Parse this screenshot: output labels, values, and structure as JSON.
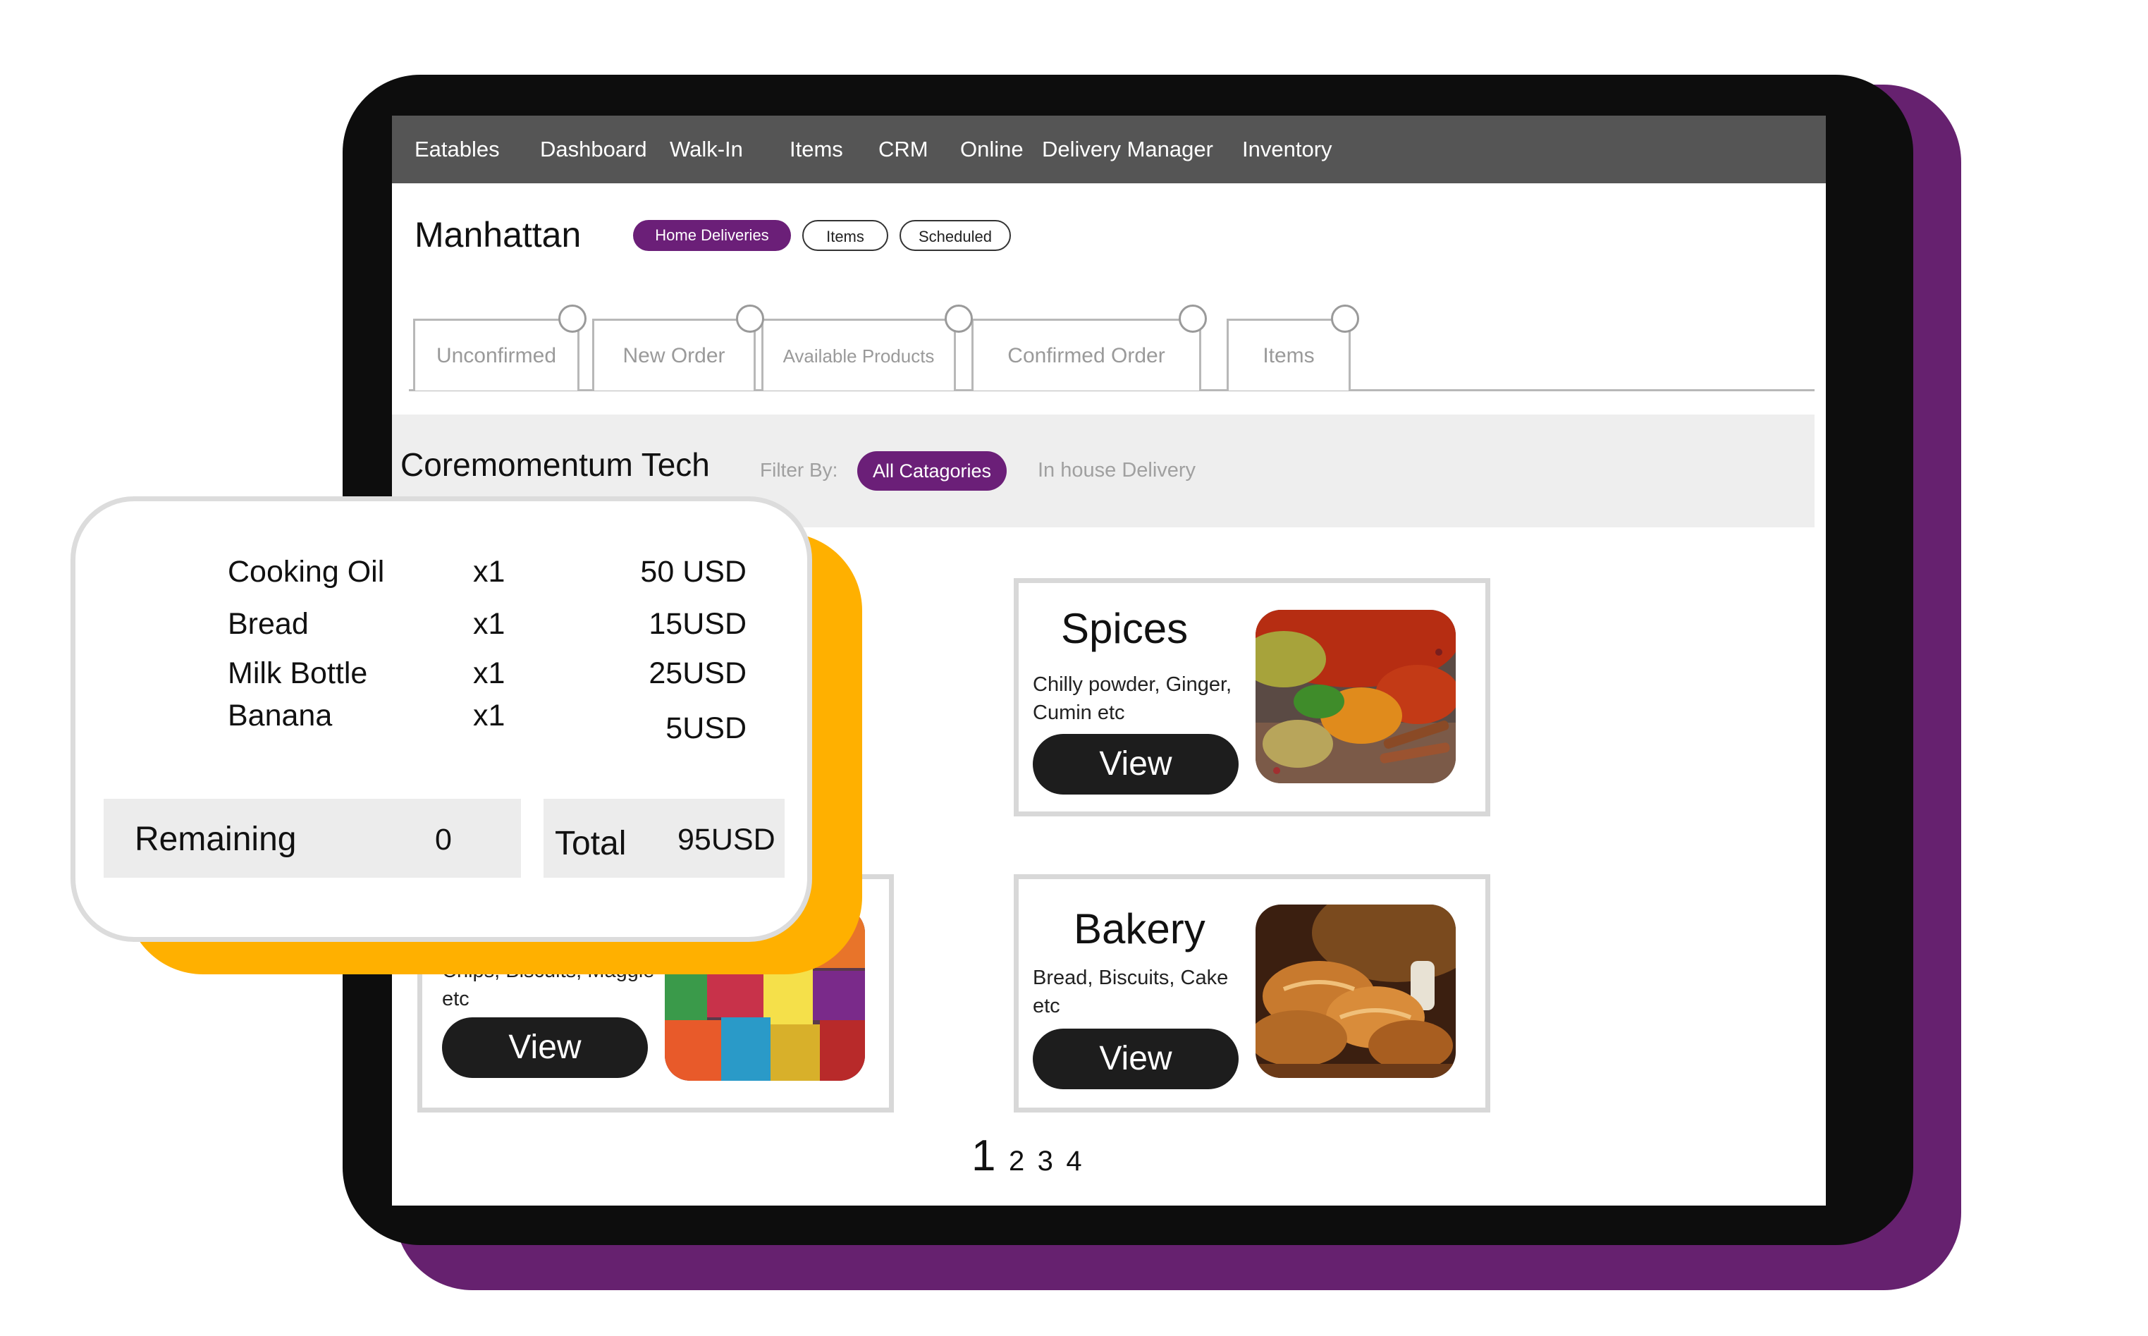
{
  "nav": {
    "items": [
      "Eatables",
      "Dashboard",
      "Walk-In",
      "Items",
      "CRM",
      "Online",
      "Delivery Manager",
      "Inventory"
    ]
  },
  "location": {
    "title": "Manhattan",
    "pills": [
      "Home Deliveries",
      "Items",
      "Scheduled"
    ],
    "active_pill": "Home Deliveries"
  },
  "tabs": [
    "Unconfirmed",
    "New Order",
    "Available Products",
    "Confirmed Order",
    "Items"
  ],
  "filter": {
    "company": "Coremomentum Tech",
    "label": "Filter By:",
    "active": "All Catagories",
    "option": "In house Delivery"
  },
  "cards": [
    {
      "title": "Spices",
      "desc_line1": "Chilly powder, Ginger,",
      "desc_line2": "Cumin etc",
      "button": "View",
      "image": "spices-photo"
    },
    {
      "title": "Bakery",
      "desc_line1": "Bread, Biscuits, Cake",
      "desc_line2": "etc",
      "button": "View",
      "image": "bakery-photo"
    },
    {
      "title": "",
      "desc_line1": "Chips, Biscuits, Maggie",
      "desc_line2": "etc",
      "button": "View",
      "image": "snacks-photo"
    }
  ],
  "pagination": {
    "current": "1",
    "pages": [
      "2",
      "3",
      "4"
    ]
  },
  "order": {
    "items": [
      {
        "name": "Cooking Oil",
        "qty": "x1",
        "price": "50 USD"
      },
      {
        "name": "Bread",
        "qty": "x1",
        "price": "15USD"
      },
      {
        "name": "Milk Bottle",
        "qty": "x1",
        "price": "25USD"
      },
      {
        "name": "Banana",
        "qty": "x1",
        "price": "5USD"
      }
    ],
    "remaining_label": "Remaining",
    "remaining_value": "0",
    "total_label": "Total",
    "total_value": "95USD"
  },
  "colors": {
    "accent_purple": "#6b1f78",
    "backdrop_purple": "#66216f",
    "accent_yellow": "#ffb000",
    "nav_gray": "#555555"
  }
}
